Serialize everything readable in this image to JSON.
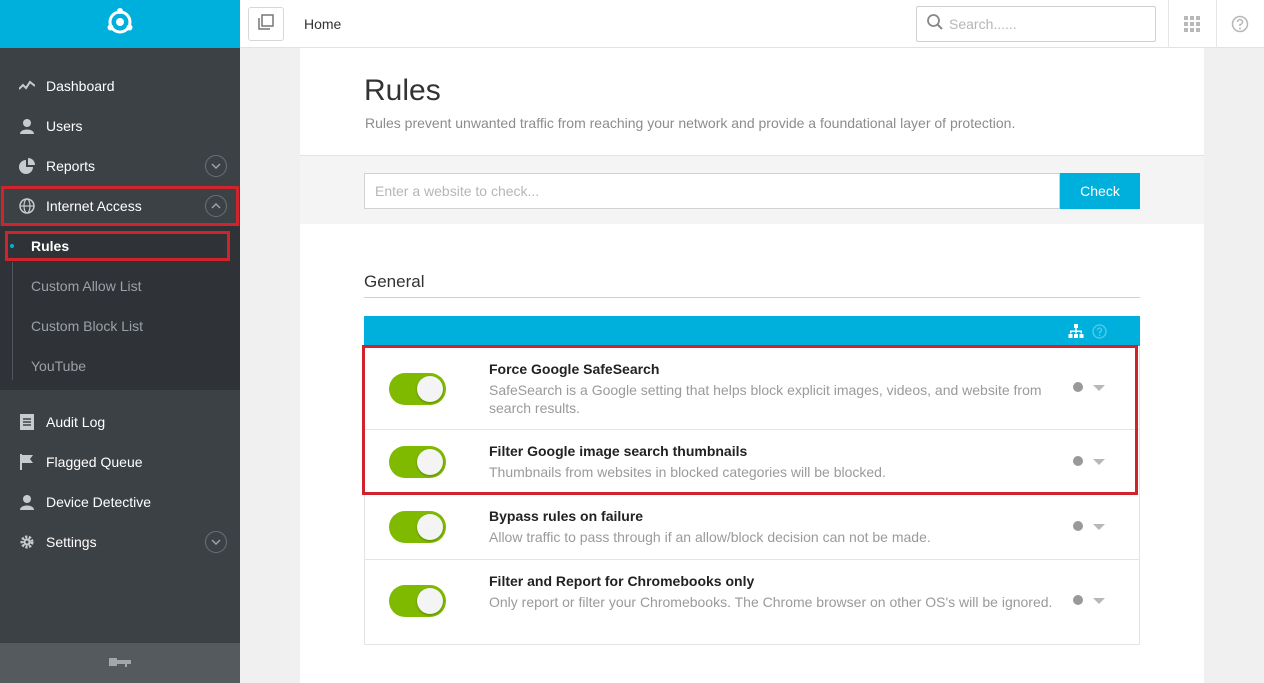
{
  "sidebar": {
    "primary_items": [
      {
        "label": "Dashboard",
        "icon": "activity-icon"
      },
      {
        "label": "Users",
        "icon": "user-icon"
      },
      {
        "label": "Reports",
        "icon": "pie-chart-icon"
      },
      {
        "label": "Internet Access",
        "icon": "globe-icon"
      }
    ],
    "sub_items": [
      "Rules",
      "Custom Allow List",
      "Custom Block List",
      "YouTube"
    ],
    "secondary_items": [
      {
        "label": "Audit Log",
        "icon": "document-icon"
      },
      {
        "label": "Flagged Queue",
        "icon": "flag-icon"
      },
      {
        "label": "Device Detective",
        "icon": "user-icon"
      },
      {
        "label": "Settings",
        "icon": "gear-icon"
      }
    ]
  },
  "topbar": {
    "breadcrumb": "Home",
    "search_placeholder": "Search......"
  },
  "page": {
    "title": "Rules",
    "subtitle": "Rules prevent unwanted traffic from reaching your network and provide a foundational layer of protection.",
    "check_placeholder": "Enter a website to check...",
    "check_button": "Check",
    "section_title": "General"
  },
  "rules": [
    {
      "title": "Force Google SafeSearch",
      "description": "SafeSearch is a Google setting that helps block explicit images, videos, and website from search results.",
      "enabled": true
    },
    {
      "title": "Filter Google image search thumbnails",
      "description": "Thumbnails from websites in blocked categories will be blocked.",
      "enabled": true
    },
    {
      "title": "Bypass rules on failure",
      "description": "Allow traffic to pass through if an allow/block decision can not be made.",
      "enabled": true
    },
    {
      "title": "Filter and Report for Chromebooks only",
      "description": "Only report or filter your Chromebooks. The Chrome browser on other OS's will be ignored.",
      "enabled": true
    }
  ],
  "colors": {
    "accent": "#00b0dc",
    "sidebar_bg": "#3c4146",
    "toggle_on": "#7fba00",
    "highlight_box": "#d0232b"
  }
}
